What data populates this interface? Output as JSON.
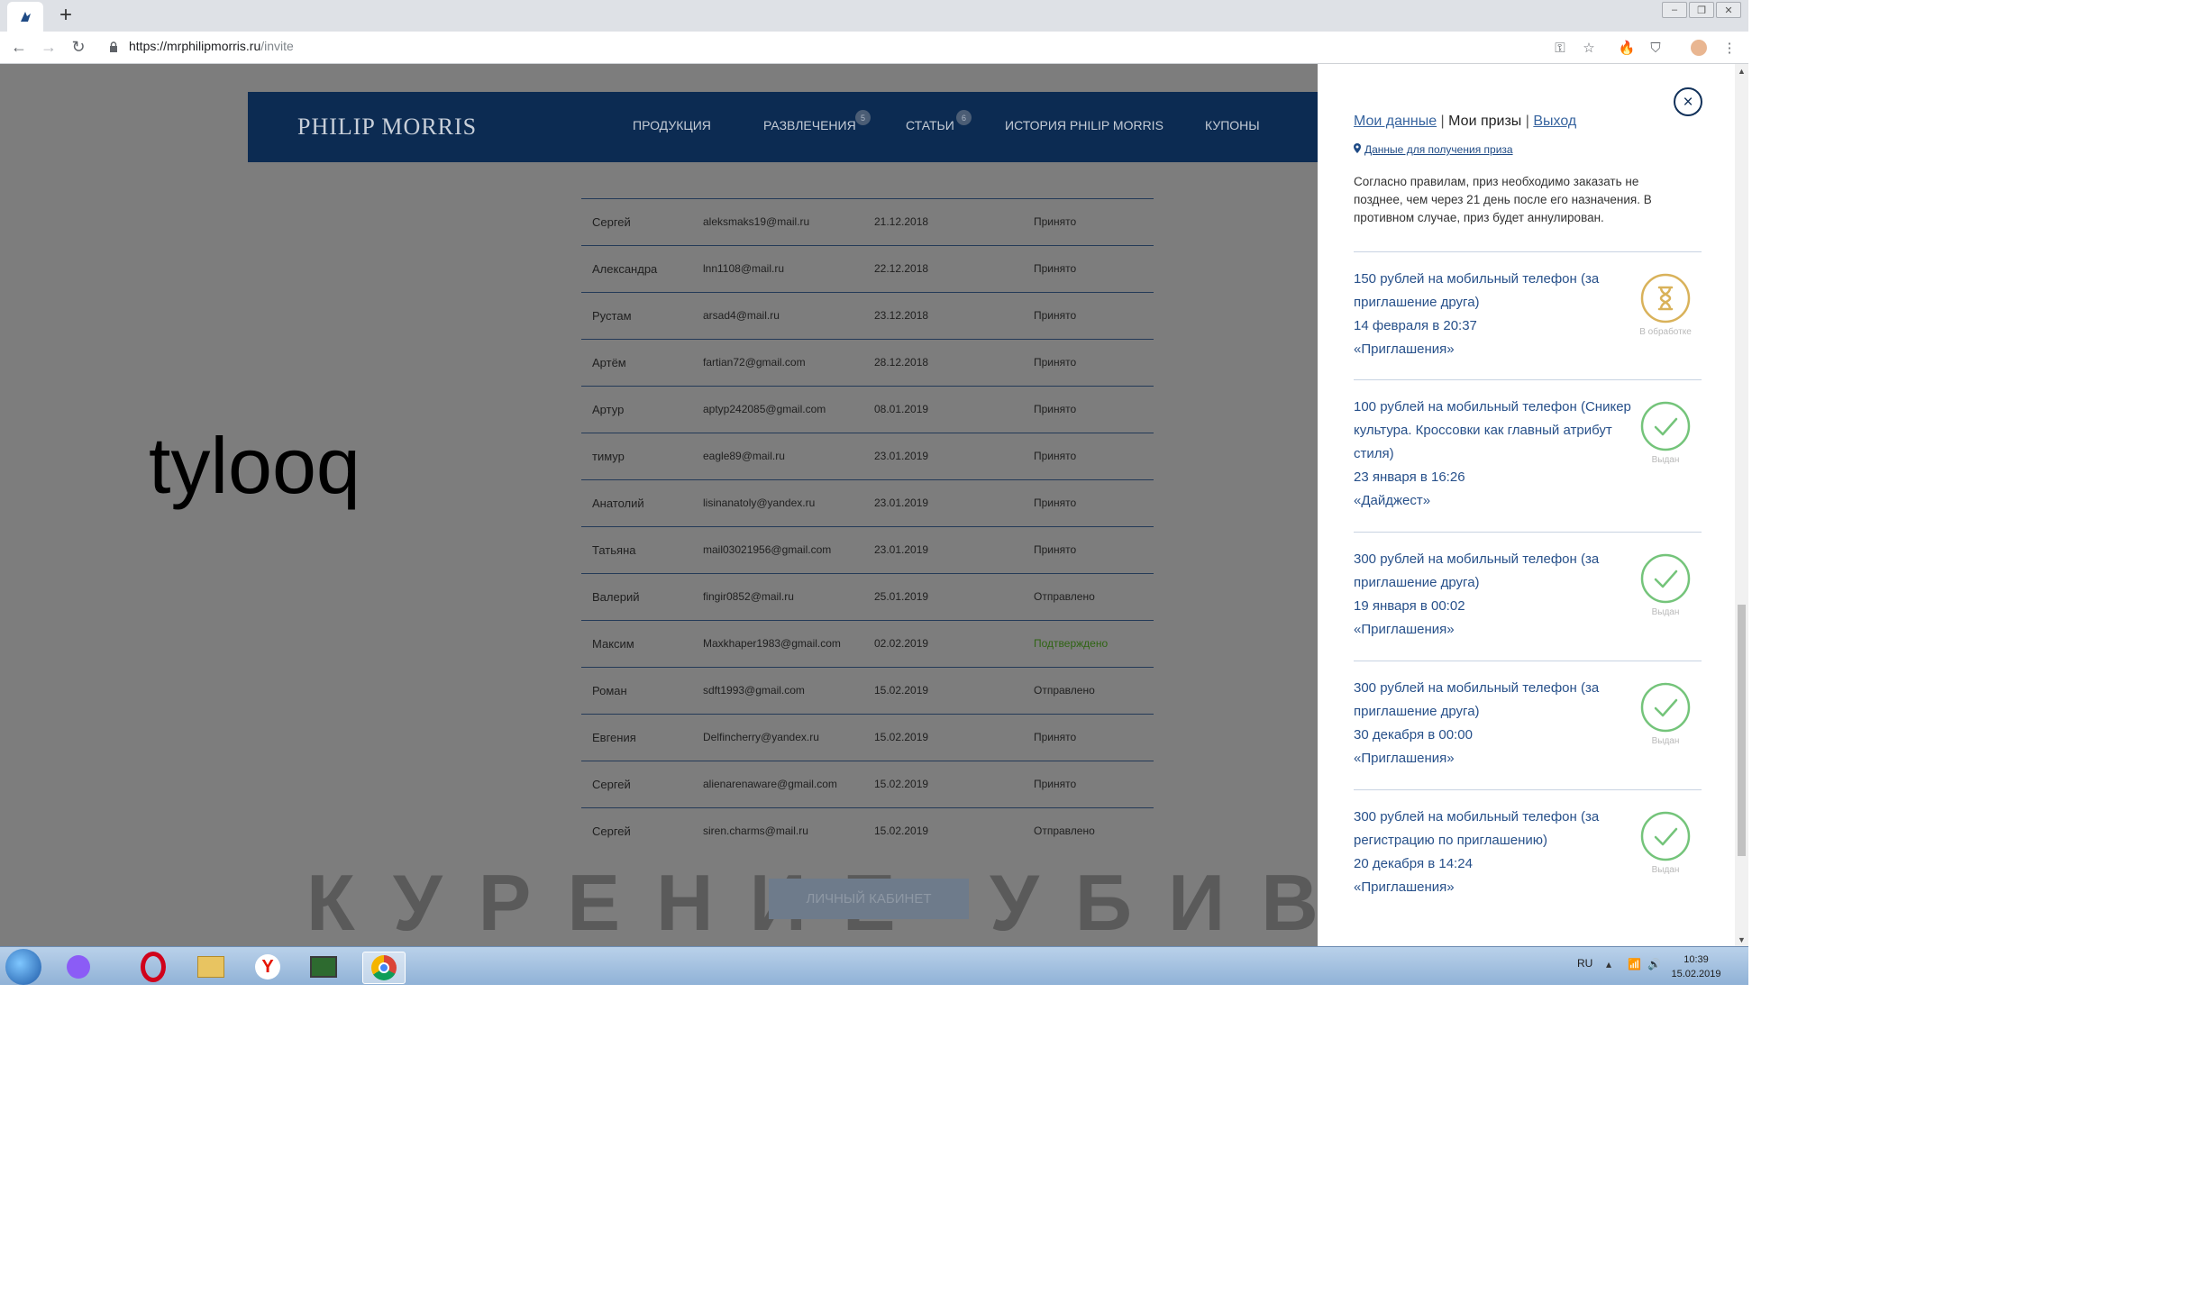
{
  "browser": {
    "url_domain": "https://mrphilipmorris.ru",
    "url_path": "/invite"
  },
  "site": {
    "logo": "PHILIP MORRIS",
    "menu": [
      {
        "label": "ПРОДУКЦИЯ"
      },
      {
        "label": "РАЗВЛЕЧЕНИЯ",
        "badge": "5"
      },
      {
        "label": "СТАТЬИ",
        "badge": "6"
      },
      {
        "label": "ИСТОРИЯ PHILIP MORRIS"
      },
      {
        "label": "КУПОНЫ"
      }
    ]
  },
  "invites": [
    {
      "name": "Сергей",
      "email": "aleksmaks19@mail.ru",
      "date": "21.12.2018",
      "status": "Принято"
    },
    {
      "name": "Александра",
      "email": "lnn1108@mail.ru",
      "date": "22.12.2018",
      "status": "Принято"
    },
    {
      "name": "Рустам",
      "email": "arsad4@mail.ru",
      "date": "23.12.2018",
      "status": "Принято"
    },
    {
      "name": "Артём",
      "email": "fartian72@gmail.com",
      "date": "28.12.2018",
      "status": "Принято"
    },
    {
      "name": "Артур",
      "email": "aptyp242085@gmail.com",
      "date": "08.01.2019",
      "status": "Принято"
    },
    {
      "name": "тимур",
      "email": "eagle89@mail.ru",
      "date": "23.01.2019",
      "status": "Принято"
    },
    {
      "name": "Анатолий",
      "email": "lisinanatoly@yandex.ru",
      "date": "23.01.2019",
      "status": "Принято"
    },
    {
      "name": "Татьяна",
      "email": "mail03021956@gmail.com",
      "date": "23.01.2019",
      "status": "Принято"
    },
    {
      "name": "Валерий",
      "email": "fingir0852@mail.ru",
      "date": "25.01.2019",
      "status": "Отправлено"
    },
    {
      "name": "Максим",
      "email": "Maxkhaper1983@gmail.com",
      "date": "02.02.2019",
      "status": "Подтверждено"
    },
    {
      "name": "Роман",
      "email": "sdft1993@gmail.com",
      "date": "15.02.2019",
      "status": "Отправлено"
    },
    {
      "name": "Евгения",
      "email": "Delfincherry@yandex.ru",
      "date": "15.02.2019",
      "status": "Принято"
    },
    {
      "name": "Сергей",
      "email": "alienarenaware@gmail.com",
      "date": "15.02.2019",
      "status": "Принято"
    },
    {
      "name": "Сергей",
      "email": "siren.charms@mail.ru",
      "date": "15.02.2019",
      "status": "Отправлено"
    }
  ],
  "warning_watermark": "КУРЕНИЕ УБИВАЕТ",
  "cabinet_button": "ЛИЧНЫЙ КАБИНЕТ",
  "overlay_text": "tylooq",
  "panel": {
    "tab_my_data": "Мои данные",
    "tab_my_prizes": "Мои призы",
    "tab_logout": "Выход",
    "separator": "|",
    "pin_link": "Данные для получения приза",
    "rules_note": "Согласно правилам, приз необходимо заказать не позднее, чем через 21 день после его назначения. В противном случае, приз будет аннулирован.",
    "prizes": [
      {
        "title": "150 рублей на мобильный телефон (за приглашение друга)",
        "datetime": "14 февраля в 20:37",
        "source": "«Приглашения»",
        "status": "В обработке",
        "icon": "hourglass-icon"
      },
      {
        "title": "100 рублей на мобильный телефон (Сникер культура. Кроссовки как главный атрибут стиля)",
        "datetime": "23 января в 16:26",
        "source": "«Дайджест»",
        "status": "Выдан",
        "icon": "checkmark-icon"
      },
      {
        "title": "300 рублей на мобильный телефон (за приглашение друга)",
        "datetime": "19 января в 00:02",
        "source": "«Приглашения»",
        "status": "Выдан",
        "icon": "checkmark-icon"
      },
      {
        "title": "300 рублей на мобильный телефон (за приглашение друга)",
        "datetime": "30 декабря в 00:00",
        "source": "«Приглашения»",
        "status": "Выдан",
        "icon": "checkmark-icon"
      },
      {
        "title": "300 рублей на мобильный телефон (за регистрацию по приглашению)",
        "datetime": "20 декабря в 14:24",
        "source": "«Приглашения»",
        "status": "Выдан",
        "icon": "checkmark-icon"
      }
    ]
  },
  "taskbar": {
    "lang": "RU",
    "time": "10:39",
    "date": "15.02.2019"
  },
  "colors": {
    "header_navy": "#0c2b52",
    "prize_text_blue": "#27508a",
    "pending_gold": "#d9b25a",
    "success_green": "#74c47a"
  }
}
